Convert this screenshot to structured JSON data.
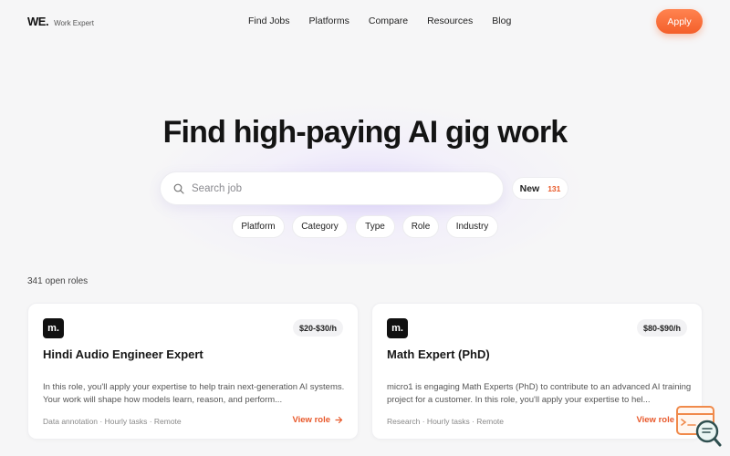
{
  "header": {
    "logo_mark": "WE.",
    "logo_text": "Work Expert",
    "nav": [
      "Find Jobs",
      "Platforms",
      "Compare",
      "Resources",
      "Blog"
    ],
    "apply_label": "Apply"
  },
  "hero": {
    "title": "Find high-paying AI gig work",
    "search_placeholder": "Search job",
    "new_label": "New",
    "new_count": "131",
    "filters": [
      "Platform",
      "Category",
      "Type",
      "Role",
      "Industry"
    ]
  },
  "listing": {
    "open_roles": "341 open roles",
    "cards": [
      {
        "logo": "m.",
        "pay": "$20-$30/h",
        "title": "Hindi Audio Engineer Expert",
        "description": "In this role, you'll apply your expertise to help train next-generation AI systems. Your work will shape how models learn, reason, and perform...",
        "tags": "Data annotation · Hourly tasks · Remote",
        "view_label": "View role"
      },
      {
        "logo": "m.",
        "pay": "$80-$90/h",
        "title": "Math Expert (PhD)",
        "description": "micro1 is engaging Math Experts (PhD) to contribute to an advanced AI training project for a customer. In this role, you'll apply your expertise to hel...",
        "tags": "Research · Hourly tasks · Remote",
        "view_label": "View role"
      }
    ]
  },
  "colors": {
    "accent": "#f45f2a",
    "background": "#f6f6f7",
    "text": "#141414"
  },
  "icons": [
    "search-icon",
    "arrow-right-icon",
    "chat-search-icon"
  ]
}
